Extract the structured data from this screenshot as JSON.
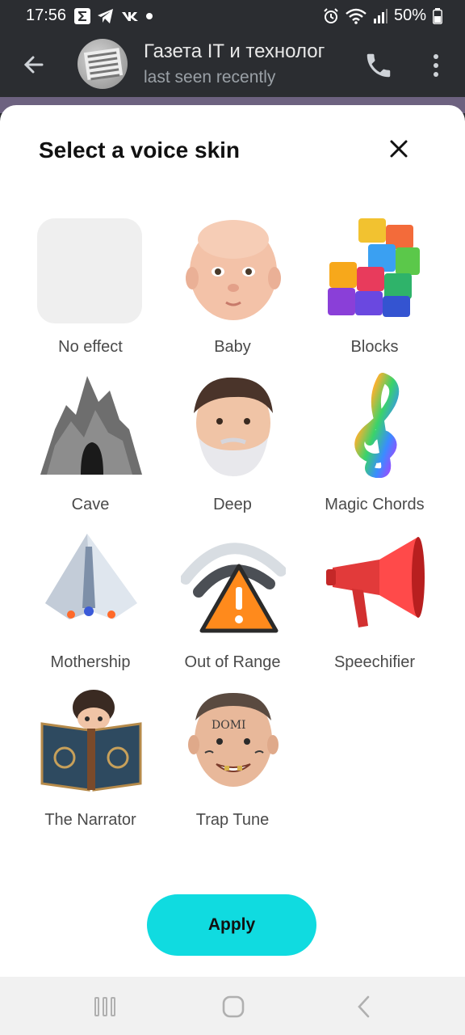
{
  "status_bar": {
    "time": "17:56",
    "battery_percent": "50%"
  },
  "chat_header": {
    "title": "Газета IT и технолог",
    "subtitle": "last seen recently",
    "avatar_text": "Газета IT и технологии"
  },
  "sheet": {
    "title": "Select a voice skin",
    "skins": [
      {
        "label": "No effect",
        "icon": "no-effect"
      },
      {
        "label": "Baby",
        "icon": "baby-face-icon"
      },
      {
        "label": "Blocks",
        "icon": "blocks-icon"
      },
      {
        "label": "Cave",
        "icon": "cave-icon"
      },
      {
        "label": "Deep",
        "icon": "bearded-man-icon"
      },
      {
        "label": "Magic Chords",
        "icon": "treble-clef-icon"
      },
      {
        "label": "Mothership",
        "icon": "spaceship-icon"
      },
      {
        "label": "Out of Range",
        "icon": "warning-signal-icon"
      },
      {
        "label": "Speechifier",
        "icon": "megaphone-icon"
      },
      {
        "label": "The Narrator",
        "icon": "narrator-book-icon"
      },
      {
        "label": "Trap Tune",
        "icon": "tattooed-face-icon"
      }
    ],
    "apply_label": "Apply"
  },
  "colors": {
    "accent": "#10dbe0",
    "header_bg": "#2b2d31"
  }
}
